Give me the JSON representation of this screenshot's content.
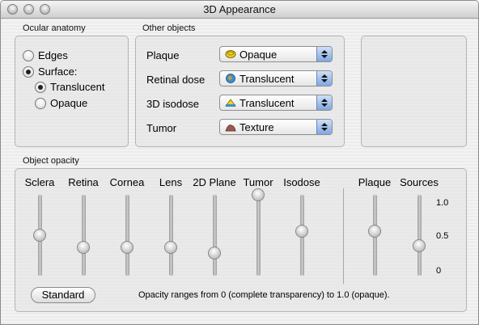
{
  "window": {
    "title": "3D Appearance"
  },
  "ocular": {
    "label": "Ocular anatomy",
    "edges": "Edges",
    "surface": "Surface:",
    "translucent": "Translucent",
    "opaque": "Opaque",
    "selected_mode": "Surface",
    "selected_surface": "Translucent"
  },
  "other": {
    "label": "Other objects",
    "rows": [
      {
        "label": "Plaque",
        "value": "Opaque",
        "icon": "plaque-icon"
      },
      {
        "label": "Retinal dose",
        "value": "Translucent",
        "icon": "globe-icon"
      },
      {
        "label": "3D isodose",
        "value": "Translucent",
        "icon": "isodose-icon"
      },
      {
        "label": "Tumor",
        "value": "Texture",
        "icon": "tumor-icon"
      }
    ]
  },
  "opacity": {
    "label": "Object opacity",
    "sliders": [
      {
        "label": "Sclera",
        "value": 0.5
      },
      {
        "label": "Retina",
        "value": 0.35
      },
      {
        "label": "Cornea",
        "value": 0.35
      },
      {
        "label": "Lens",
        "value": 0.35
      },
      {
        "label": "2D Plane",
        "value": 0.28
      },
      {
        "label": "Tumor",
        "value": 1.0
      },
      {
        "label": "Isodose",
        "value": 0.55
      },
      {
        "label": "Plaque",
        "value": 0.55
      },
      {
        "label": "Sources",
        "value": 0.37
      }
    ],
    "scale": [
      "1.0",
      "0.5",
      "0"
    ],
    "standard_button": "Standard",
    "note": "Opacity ranges from 0 (complete transparency) to 1.0 (opaque)."
  }
}
